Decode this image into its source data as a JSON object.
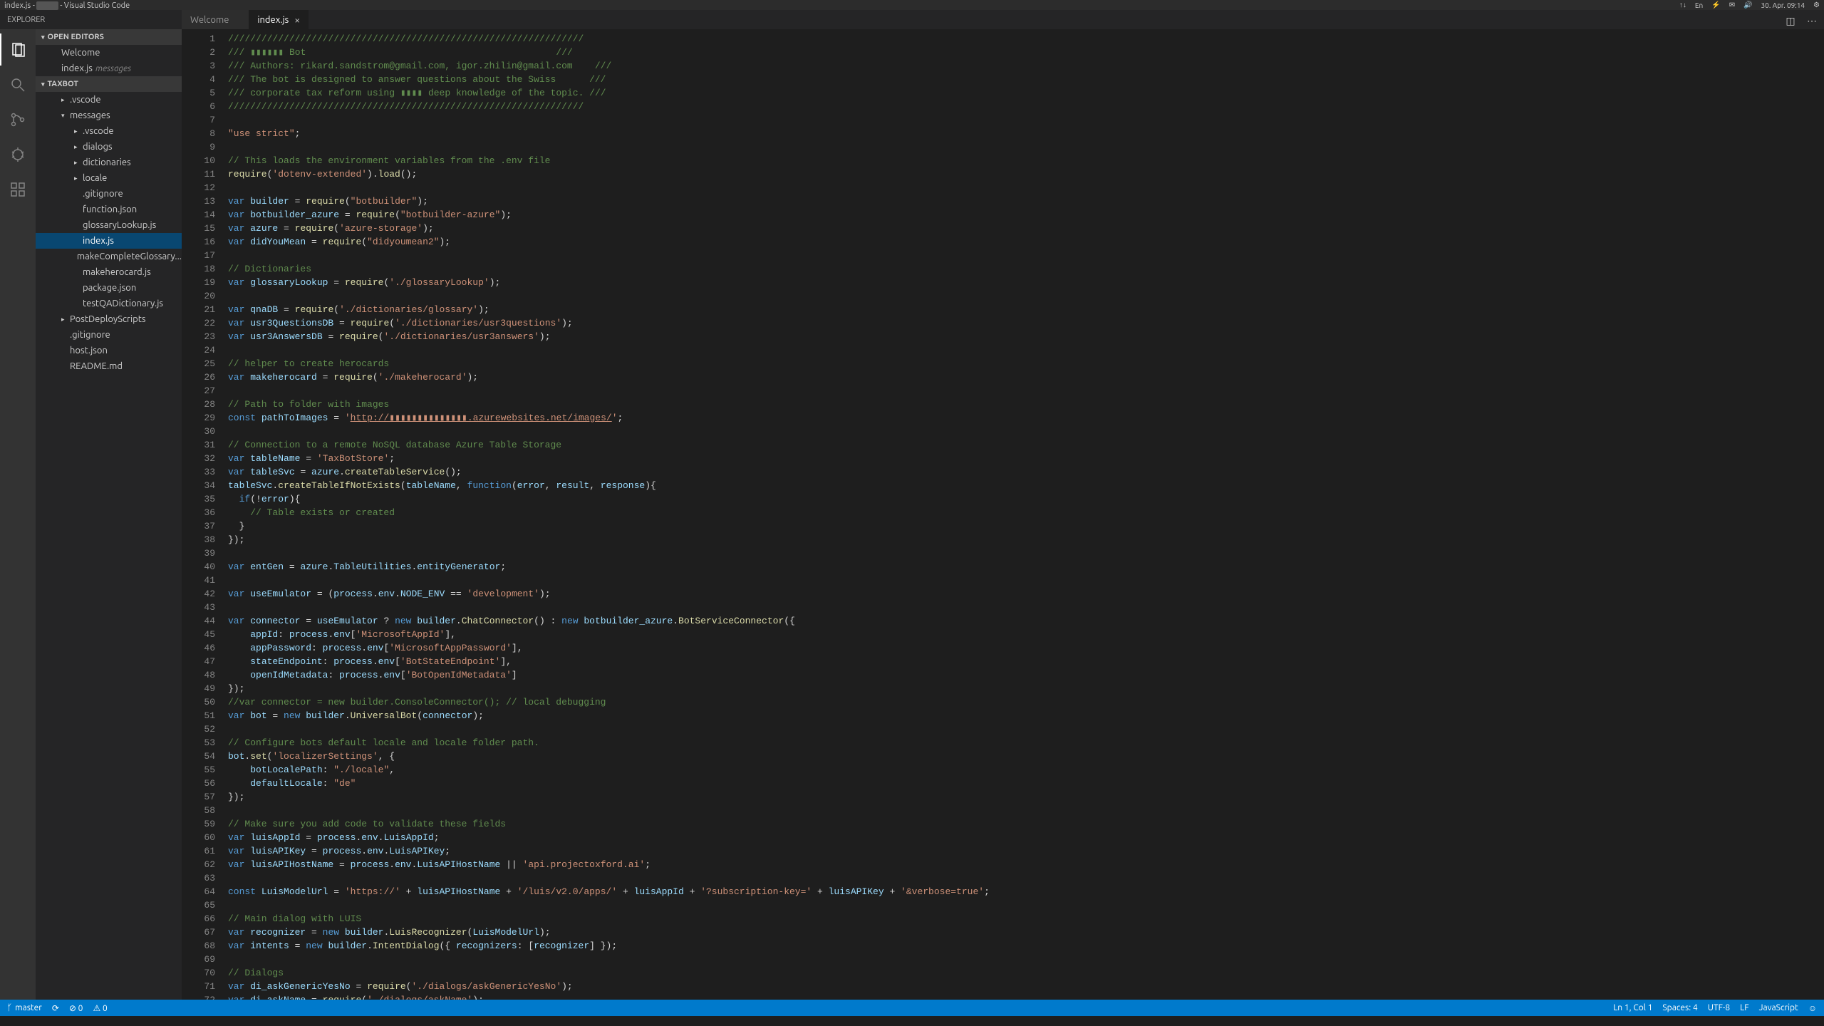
{
  "os_topbar": {
    "title_prefix": "index.js - ",
    "title_suffix": " - Visual Studio Code",
    "indicators": [
      "↑↓",
      "En",
      "⚡",
      "✉",
      "🔊",
      "30. Apr. 09:14",
      "⚙"
    ]
  },
  "explorer": {
    "title": "EXPLORER"
  },
  "sections": {
    "open_editors": "OPEN EDITORS",
    "project": "TAXBOT"
  },
  "open_editors_items": [
    {
      "label": "Welcome"
    },
    {
      "label": "index.js",
      "path": "messages"
    }
  ],
  "tree": [
    {
      "label": ".vscode",
      "indent": 1,
      "arrow": true
    },
    {
      "label": "messages",
      "indent": 1,
      "arrow": true,
      "expanded": true
    },
    {
      "label": ".vscode",
      "indent": 2,
      "arrow": true
    },
    {
      "label": "dialogs",
      "indent": 2,
      "arrow": true
    },
    {
      "label": "dictionaries",
      "indent": 2,
      "arrow": true
    },
    {
      "label": "locale",
      "indent": 2,
      "arrow": true
    },
    {
      "label": ".gitignore",
      "indent": 2
    },
    {
      "label": "function.json",
      "indent": 2
    },
    {
      "label": "glossaryLookup.js",
      "indent": 2
    },
    {
      "label": "index.js",
      "indent": 2,
      "selected": true
    },
    {
      "label": "makeCompleteGlossary...",
      "indent": 2
    },
    {
      "label": "makeherocard.js",
      "indent": 2
    },
    {
      "label": "package.json",
      "indent": 2
    },
    {
      "label": "testQADictionary.js",
      "indent": 2
    },
    {
      "label": "PostDeployScripts",
      "indent": 1,
      "arrow": true
    },
    {
      "label": ".gitignore",
      "indent": 1
    },
    {
      "label": "host.json",
      "indent": 1
    },
    {
      "label": "README.md",
      "indent": 1
    }
  ],
  "tabs": [
    {
      "label": "Welcome",
      "active": false
    },
    {
      "label": "index.js",
      "active": true
    }
  ],
  "code_lines": [
    {
      "n": 1,
      "t": "comment",
      "text": "////////////////////////////////////////////////////////////////"
    },
    {
      "n": 2,
      "t": "comment",
      "text": "/// ▮▮▮▮▮▮ Bot                                             ///"
    },
    {
      "n": 3,
      "t": "comment",
      "text": "/// Authors: rikard.sandstrom@gmail.com, igor.zhilin@gmail.com    ///"
    },
    {
      "n": 4,
      "t": "comment",
      "text": "/// The bot is designed to answer questions about the Swiss      ///"
    },
    {
      "n": 5,
      "t": "comment",
      "text": "/// corporate tax reform using ▮▮▮▮ deep knowledge of the topic. ///"
    },
    {
      "n": 6,
      "t": "comment",
      "text": "////////////////////////////////////////////////////////////////"
    },
    {
      "n": 7,
      "t": "blank",
      "text": ""
    },
    {
      "n": 8,
      "t": "raw",
      "html": "<span class=\"c-string\">\"use strict\"</span>;"
    },
    {
      "n": 9,
      "t": "blank",
      "text": ""
    },
    {
      "n": 10,
      "t": "comment",
      "text": "// This loads the environment variables from the .env file"
    },
    {
      "n": 11,
      "t": "raw",
      "html": "<span class=\"c-func\">require</span>(<span class=\"c-string\">'dotenv-extended'</span>).<span class=\"c-func\">load</span>();"
    },
    {
      "n": 12,
      "t": "blank",
      "text": ""
    },
    {
      "n": 13,
      "t": "raw",
      "html": "<span class=\"c-keyword\">var</span> <span class=\"c-var\">builder</span> = <span class=\"c-func\">require</span>(<span class=\"c-string\">\"botbuilder\"</span>);"
    },
    {
      "n": 14,
      "t": "raw",
      "html": "<span class=\"c-keyword\">var</span> <span class=\"c-var\">botbuilder_azure</span> = <span class=\"c-func\">require</span>(<span class=\"c-string\">\"botbuilder-azure\"</span>);"
    },
    {
      "n": 15,
      "t": "raw",
      "html": "<span class=\"c-keyword\">var</span> <span class=\"c-var\">azure</span> = <span class=\"c-func\">require</span>(<span class=\"c-string\">'azure-storage'</span>);"
    },
    {
      "n": 16,
      "t": "raw",
      "html": "<span class=\"c-keyword\">var</span> <span class=\"c-var\">didYouMean</span> = <span class=\"c-func\">require</span>(<span class=\"c-string\">\"didyoumean2\"</span>);"
    },
    {
      "n": 17,
      "t": "blank",
      "text": ""
    },
    {
      "n": 18,
      "t": "comment",
      "text": "// Dictionaries"
    },
    {
      "n": 19,
      "t": "raw",
      "html": "<span class=\"c-keyword\">var</span> <span class=\"c-var\">glossaryLookup</span> = <span class=\"c-func\">require</span>(<span class=\"c-string\">'./glossaryLookup'</span>);"
    },
    {
      "n": 20,
      "t": "blank",
      "text": ""
    },
    {
      "n": 21,
      "t": "raw",
      "html": "<span class=\"c-keyword\">var</span> <span class=\"c-var\">qnaDB</span> = <span class=\"c-func\">require</span>(<span class=\"c-string\">'./dictionaries/glossary'</span>);"
    },
    {
      "n": 22,
      "t": "raw",
      "html": "<span class=\"c-keyword\">var</span> <span class=\"c-var\">usr3QuestionsDB</span> = <span class=\"c-func\">require</span>(<span class=\"c-string\">'./dictionaries/usr3questions'</span>);"
    },
    {
      "n": 23,
      "t": "raw",
      "html": "<span class=\"c-keyword\">var</span> <span class=\"c-var\">usr3AnswersDB</span> = <span class=\"c-func\">require</span>(<span class=\"c-string\">'./dictionaries/usr3answers'</span>);"
    },
    {
      "n": 24,
      "t": "blank",
      "text": ""
    },
    {
      "n": 25,
      "t": "comment",
      "text": "// helper to create herocards"
    },
    {
      "n": 26,
      "t": "raw",
      "html": "<span class=\"c-keyword\">var</span> <span class=\"c-var\">makeherocard</span> = <span class=\"c-func\">require</span>(<span class=\"c-string\">'./makeherocard'</span>);"
    },
    {
      "n": 27,
      "t": "blank",
      "text": ""
    },
    {
      "n": 28,
      "t": "comment",
      "text": "// Path to folder with images"
    },
    {
      "n": 29,
      "t": "raw",
      "html": "<span class=\"c-keyword\">const</span> <span class=\"c-var\">pathToImages</span> = <span class=\"c-string\">'<span class=\"c-underline\">http://▮▮▮▮▮▮▮▮▮▮▮▮▮▮.azurewebsites.net/images/</span>'</span>;"
    },
    {
      "n": 30,
      "t": "blank",
      "text": ""
    },
    {
      "n": 31,
      "t": "comment",
      "text": "// Connection to a remote NoSQL database Azure Table Storage"
    },
    {
      "n": 32,
      "t": "raw",
      "html": "<span class=\"c-keyword\">var</span> <span class=\"c-var\">tableName</span> = <span class=\"c-string\">'TaxBotStore'</span>;"
    },
    {
      "n": 33,
      "t": "raw",
      "html": "<span class=\"c-keyword\">var</span> <span class=\"c-var\">tableSvc</span> = <span class=\"c-var\">azure</span>.<span class=\"c-func\">createTableService</span>();"
    },
    {
      "n": 34,
      "t": "raw",
      "html": "<span class=\"c-var\">tableSvc</span>.<span class=\"c-func\">createTableIfNotExists</span>(<span class=\"c-var\">tableName</span>, <span class=\"c-keyword\">function</span>(<span class=\"c-var\">error</span>, <span class=\"c-var\">result</span>, <span class=\"c-var\">response</span>){"
    },
    {
      "n": 35,
      "t": "raw",
      "html": "  <span class=\"c-keyword\">if</span>(!<span class=\"c-var\">error</span>){"
    },
    {
      "n": 36,
      "t": "comment",
      "text": "    // Table exists or created"
    },
    {
      "n": 37,
      "t": "raw",
      "html": "  }"
    },
    {
      "n": 38,
      "t": "raw",
      "html": "});"
    },
    {
      "n": 39,
      "t": "blank",
      "text": ""
    },
    {
      "n": 40,
      "t": "raw",
      "html": "<span class=\"c-keyword\">var</span> <span class=\"c-var\">entGen</span> = <span class=\"c-var\">azure</span>.<span class=\"c-var\">TableUtilities</span>.<span class=\"c-var\">entityGenerator</span>;"
    },
    {
      "n": 41,
      "t": "blank",
      "text": ""
    },
    {
      "n": 42,
      "t": "raw",
      "html": "<span class=\"c-keyword\">var</span> <span class=\"c-var\">useEmulator</span> = (<span class=\"c-var\">process</span>.<span class=\"c-var\">env</span>.<span class=\"c-var\">NODE_ENV</span> == <span class=\"c-string\">'development'</span>);"
    },
    {
      "n": 43,
      "t": "blank",
      "text": ""
    },
    {
      "n": 44,
      "t": "raw",
      "html": "<span class=\"c-keyword\">var</span> <span class=\"c-var\">connector</span> = <span class=\"c-var\">useEmulator</span> ? <span class=\"c-keyword\">new</span> <span class=\"c-var\">builder</span>.<span class=\"c-func\">ChatConnector</span>() : <span class=\"c-keyword\">new</span> <span class=\"c-var\">botbuilder_azure</span>.<span class=\"c-func\">BotServiceConnector</span>({"
    },
    {
      "n": 45,
      "t": "raw",
      "html": "    <span class=\"c-var\">appId</span>: <span class=\"c-var\">process</span>.<span class=\"c-var\">env</span>[<span class=\"c-string\">'MicrosoftAppId'</span>],"
    },
    {
      "n": 46,
      "t": "raw",
      "html": "    <span class=\"c-var\">appPassword</span>: <span class=\"c-var\">process</span>.<span class=\"c-var\">env</span>[<span class=\"c-string\">'MicrosoftAppPassword'</span>],"
    },
    {
      "n": 47,
      "t": "raw",
      "html": "    <span class=\"c-var\">stateEndpoint</span>: <span class=\"c-var\">process</span>.<span class=\"c-var\">env</span>[<span class=\"c-string\">'BotStateEndpoint'</span>],"
    },
    {
      "n": 48,
      "t": "raw",
      "html": "    <span class=\"c-var\">openIdMetadata</span>: <span class=\"c-var\">process</span>.<span class=\"c-var\">env</span>[<span class=\"c-string\">'BotOpenIdMetadata'</span>]"
    },
    {
      "n": 49,
      "t": "raw",
      "html": "});"
    },
    {
      "n": 50,
      "t": "comment",
      "text": "//var connector = new builder.ConsoleConnector(); // local debugging"
    },
    {
      "n": 51,
      "t": "raw",
      "html": "<span class=\"c-keyword\">var</span> <span class=\"c-var\">bot</span> = <span class=\"c-keyword\">new</span> <span class=\"c-var\">builder</span>.<span class=\"c-func\">UniversalBot</span>(<span class=\"c-var\">connector</span>);"
    },
    {
      "n": 52,
      "t": "blank",
      "text": ""
    },
    {
      "n": 53,
      "t": "comment",
      "text": "// Configure bots default locale and locale folder path."
    },
    {
      "n": 54,
      "t": "raw",
      "html": "<span class=\"c-var\">bot</span>.<span class=\"c-func\">set</span>(<span class=\"c-string\">'localizerSettings'</span>, {"
    },
    {
      "n": 55,
      "t": "raw",
      "html": "    <span class=\"c-var\">botLocalePath</span>: <span class=\"c-string\">\"./locale\"</span>,"
    },
    {
      "n": 56,
      "t": "raw",
      "html": "    <span class=\"c-var\">defaultLocale</span>: <span class=\"c-string\">\"de\"</span>"
    },
    {
      "n": 57,
      "t": "raw",
      "html": "});"
    },
    {
      "n": 58,
      "t": "blank",
      "text": ""
    },
    {
      "n": 59,
      "t": "comment",
      "text": "// Make sure you add code to validate these fields"
    },
    {
      "n": 60,
      "t": "raw",
      "html": "<span class=\"c-keyword\">var</span> <span class=\"c-var\">luisAppId</span> = <span class=\"c-var\">process</span>.<span class=\"c-var\">env</span>.<span class=\"c-var\">LuisAppId</span>;"
    },
    {
      "n": 61,
      "t": "raw",
      "html": "<span class=\"c-keyword\">var</span> <span class=\"c-var\">luisAPIKey</span> = <span class=\"c-var\">process</span>.<span class=\"c-var\">env</span>.<span class=\"c-var\">LuisAPIKey</span>;"
    },
    {
      "n": 62,
      "t": "raw",
      "html": "<span class=\"c-keyword\">var</span> <span class=\"c-var\">luisAPIHostName</span> = <span class=\"c-var\">process</span>.<span class=\"c-var\">env</span>.<span class=\"c-var\">LuisAPIHostName</span> || <span class=\"c-string\">'api.projectoxford.ai'</span>;"
    },
    {
      "n": 63,
      "t": "blank",
      "text": ""
    },
    {
      "n": 64,
      "t": "raw",
      "html": "<span class=\"c-keyword\">const</span> <span class=\"c-var\">LuisModelUrl</span> = <span class=\"c-string\">'https://'</span> + <span class=\"c-var\">luisAPIHostName</span> + <span class=\"c-string\">'/luis/v2.0/apps/'</span> + <span class=\"c-var\">luisAppId</span> + <span class=\"c-string\">'?subscription-key='</span> + <span class=\"c-var\">luisAPIKey</span> + <span class=\"c-string\">'&amp;verbose=true'</span>;"
    },
    {
      "n": 65,
      "t": "blank",
      "text": ""
    },
    {
      "n": 66,
      "t": "comment",
      "text": "// Main dialog with LUIS"
    },
    {
      "n": 67,
      "t": "raw",
      "html": "<span class=\"c-keyword\">var</span> <span class=\"c-var\">recognizer</span> = <span class=\"c-keyword\">new</span> <span class=\"c-var\">builder</span>.<span class=\"c-func\">LuisRecognizer</span>(<span class=\"c-var\">LuisModelUrl</span>);"
    },
    {
      "n": 68,
      "t": "raw",
      "html": "<span class=\"c-keyword\">var</span> <span class=\"c-var\">intents</span> = <span class=\"c-keyword\">new</span> <span class=\"c-var\">builder</span>.<span class=\"c-func\">IntentDialog</span>({ <span class=\"c-var\">recognizers</span>: [<span class=\"c-var\">recognizer</span>] });"
    },
    {
      "n": 69,
      "t": "blank",
      "text": ""
    },
    {
      "n": 70,
      "t": "comment",
      "text": "// Dialogs"
    },
    {
      "n": 71,
      "t": "raw",
      "html": "<span class=\"c-keyword\">var</span> <span class=\"c-var\">di_askGenericYesNo</span> = <span class=\"c-func\">require</span>(<span class=\"c-string\">'./dialogs/askGenericYesNo'</span>);"
    },
    {
      "n": 72,
      "t": "raw",
      "html": "<span class=\"c-keyword\">var</span> <span class=\"c-var\">di_askName</span> = <span class=\"c-func\">require</span>(<span class=\"c-string\">'./dialogs/askName'</span>);"
    }
  ],
  "status": {
    "branch": "master",
    "sync": "⟳",
    "errors": "⊘ 0",
    "warnings": "⚠ 0",
    "cursor": "Ln 1, Col 1",
    "spaces": "Spaces: 4",
    "encoding": "UTF-8",
    "eol": "LF",
    "lang": "JavaScript",
    "feedback": "☺"
  }
}
